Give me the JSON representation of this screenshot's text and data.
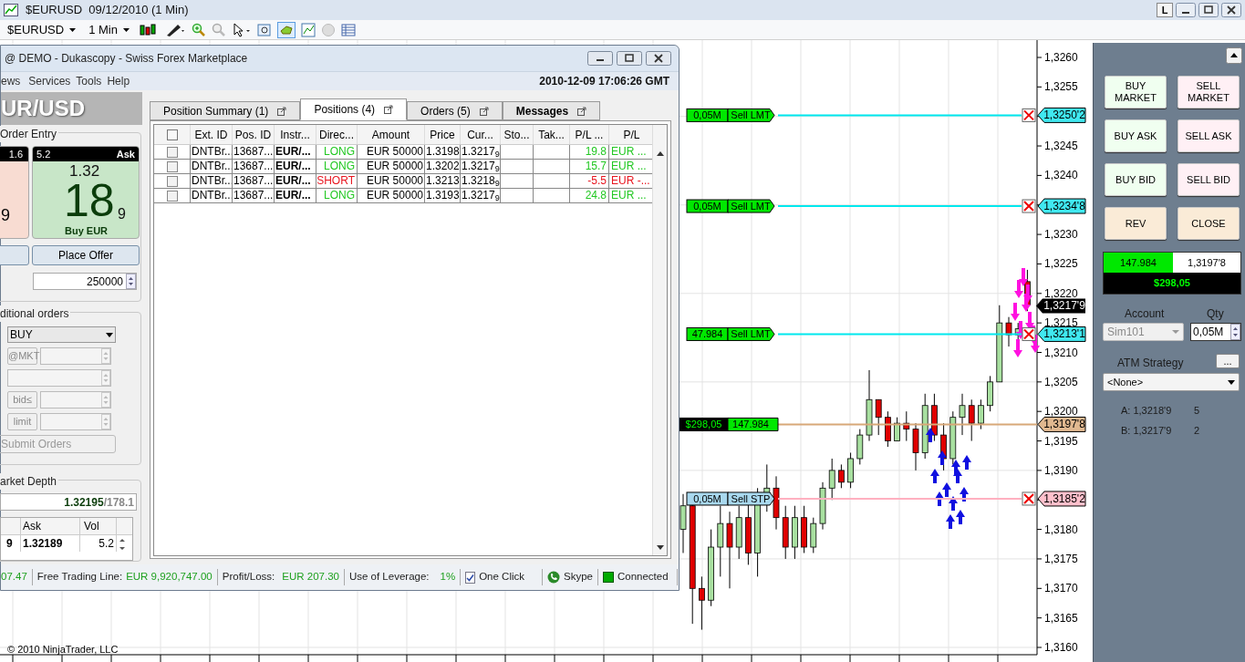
{
  "window": {
    "title": "$EURUSD  09/12/2010 (1 Min)",
    "buttons": [
      "L"
    ]
  },
  "toolbar": {
    "instrument": "$EURUSD",
    "interval": "1 Min"
  },
  "dukascopy": {
    "title": "@ DEMO - Dukascopy - Swiss Forex Marketplace",
    "menu": [
      "ews",
      "Services",
      "Tools",
      "Help"
    ],
    "datetime": "2010-12-09 17:06:26 GMT",
    "pair": "UR/USD",
    "order_entry": {
      "label": "Order Entry",
      "sell_volume": "1.6",
      "sell_pipette": "9",
      "ask_volume": "5.2",
      "ask_side": "Ask",
      "ask_prefix": "1.32",
      "ask_big": "18",
      "ask_pipette": "9",
      "ask_action": "Buy EUR",
      "place_offer": "Place Offer",
      "amount": "250000"
    },
    "conditional": {
      "label": "ditional orders",
      "side": "BUY",
      "rows": [
        "@MKT",
        "",
        "bid≤",
        "limit"
      ],
      "submit": "Submit Orders"
    },
    "market_depth": {
      "label": "arket Depth",
      "price": "1.32195",
      "volume": "/178.1",
      "columns": [
        "Ask",
        "Vol"
      ],
      "row": [
        "9",
        "1.32189",
        "5.2"
      ]
    },
    "tabs": [
      {
        "label": "Position Summary (1)",
        "selected": false
      },
      {
        "label": "Positions (4)",
        "selected": true
      },
      {
        "label": "Orders (5)",
        "selected": false
      },
      {
        "label": "Messages",
        "selected": false
      }
    ],
    "table": {
      "header_checked": false,
      "columns": [
        "Ext. ID",
        "Pos. ID",
        "Instr...",
        "Direc...",
        "Amount",
        "Price",
        "Cur...",
        "Sto...",
        "Tak...",
        "P/L ...",
        "P/L"
      ],
      "rows": [
        {
          "checked": false,
          "kind": "long",
          "cells": [
            "DNTBr...",
            "13687...",
            "EUR/...",
            "LONG",
            "EUR 50000",
            "1.3198",
            "1.3217$_{9}$",
            "",
            "",
            "19.8",
            "EUR ..."
          ]
        },
        {
          "checked": false,
          "kind": "long",
          "cells": [
            "DNTBr...",
            "13687...",
            "EUR/...",
            "LONG",
            "EUR 50000",
            "1.3202",
            "1.3217$_{9}$",
            "",
            "",
            "15.7",
            "EUR ..."
          ]
        },
        {
          "checked": false,
          "kind": "short",
          "cells": [
            "DNTBr...",
            "13687...",
            "EUR/...",
            "SHORT",
            "EUR 50000",
            "1.3213",
            "1.3218$_{9}$",
            "",
            "",
            "-5.5",
            "EUR -..."
          ]
        },
        {
          "checked": false,
          "kind": "long",
          "cells": [
            "DNTBr...",
            "13687...",
            "EUR/...",
            "LONG",
            "EUR 50000",
            "1.3193",
            "1.3217$_{9}$",
            "",
            "",
            "24.8",
            "EUR ..."
          ]
        }
      ]
    },
    "status_bar": {
      "balance": "07.47",
      "free_label": "Free Trading Line:",
      "free_value": "EUR 9,920,747.00",
      "pl_label": "Profit/Loss:",
      "pl_value": "EUR 207.30",
      "leverage_label": "Use of Leverage:",
      "leverage_value": "1%",
      "one_click": {
        "label": "One Click",
        "checked": true
      },
      "skype": "Skype",
      "connected": "Connected"
    }
  },
  "chart": {
    "copyright": "© 2010 NinjaTrader, LLC",
    "price_ticks": [
      "1,3260",
      "1,3255",
      "1,3245",
      "1,3240",
      "1,3230",
      "1,3225",
      "1,3220",
      "1,3215",
      "1,3210",
      "1,3205",
      "1,3200",
      "1,3195",
      "1,3190",
      "1,3180",
      "1,3175",
      "1,3170",
      "1,3165",
      "1,3160"
    ],
    "order_lines": [
      {
        "kind": "sell_limit",
        "qty": "0,05M",
        "label": "Sell LMT",
        "tag": "1,3250'2"
      },
      {
        "kind": "sell_limit",
        "qty": "0,05M",
        "label": "Sell LMT",
        "tag": "1,3234'8"
      },
      {
        "kind": "sell_limit",
        "qty": "47.984",
        "label": "Sell LMT",
        "tag": "1,3213'1"
      },
      {
        "kind": "position",
        "qty": "$298,05",
        "label": "147.984",
        "tag": "1,3197'8"
      },
      {
        "kind": "sell_stop",
        "qty": "0,05M",
        "label": "Sell STP",
        "tag": "1,3185'2"
      }
    ],
    "last_price": "1,3217'9"
  },
  "right_panel": {
    "buttons": [
      {
        "label": "BUY MARKET",
        "kind": "buy"
      },
      {
        "label": "SELL MARKET",
        "kind": "sell"
      },
      {
        "label": "BUY ASK",
        "kind": "buy"
      },
      {
        "label": "SELL ASK",
        "kind": "sell"
      },
      {
        "label": "BUY BID",
        "kind": "buy"
      },
      {
        "label": "SELL BID",
        "kind": "sell"
      },
      {
        "label": "REV",
        "kind": "neutral"
      },
      {
        "label": "CLOSE",
        "kind": "neutral"
      }
    ],
    "position_qty": "147.984",
    "position_price": "1,3197'8",
    "position_pl": "$298,05",
    "account_label": "Account",
    "account": "Sim101",
    "qty_label": "Qty",
    "qty": "0,05M",
    "atm_label": "ATM Strategy",
    "atm_button": "...",
    "atm_strategy": "<None>",
    "quotes": [
      {
        "label": "A: 1,3218'9",
        "size": "5"
      },
      {
        "label": "B: 1,3217'9",
        "size": "2"
      }
    ]
  }
}
